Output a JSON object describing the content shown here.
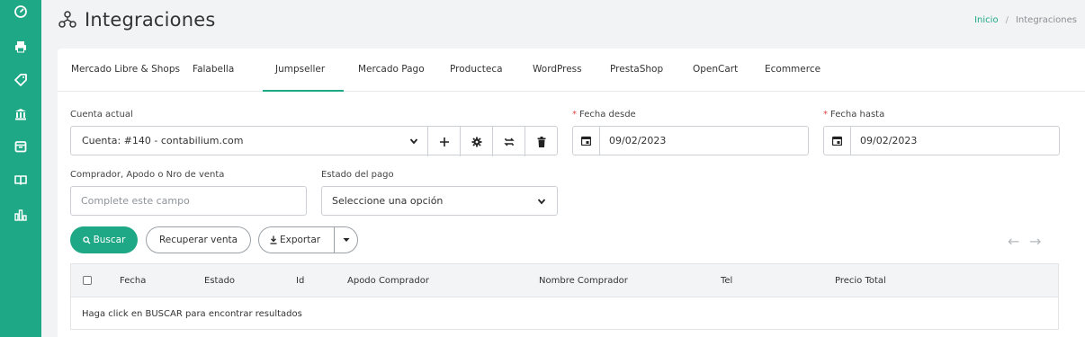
{
  "sidebar": {
    "items": [
      {
        "icon": "dashboard-gauge-icon"
      },
      {
        "icon": "printer-icon"
      },
      {
        "icon": "tag-icon"
      },
      {
        "icon": "bank-icon"
      },
      {
        "icon": "box-icon"
      },
      {
        "icon": "book-icon"
      },
      {
        "icon": "bar-chart-icon"
      }
    ]
  },
  "header": {
    "icon": "integrations-icon",
    "title": "Integraciones",
    "breadcrumb": {
      "home": "Inicio",
      "separator": "/",
      "current": "Integraciones"
    }
  },
  "tabs": [
    {
      "label": "Mercado Libre & Shops"
    },
    {
      "label": "Falabella"
    },
    {
      "label": "Jumpseller",
      "active": true
    },
    {
      "label": "Mercado Pago"
    },
    {
      "label": "Producteca"
    },
    {
      "label": "WordPress"
    },
    {
      "label": "PrestaShop"
    },
    {
      "label": "OpenCart"
    },
    {
      "label": "Ecommerce"
    }
  ],
  "form": {
    "cuenta_label": "Cuenta actual",
    "cuenta_value": "Cuenta: #140 -  contabilium.com",
    "fecha_desde_label": "Fecha desde",
    "fecha_desde_value": "09/02/2023",
    "fecha_hasta_label": "Fecha hasta",
    "fecha_hasta_value": "09/02/2023",
    "required_mark": "*",
    "comprador_label": "Comprador, Apodo o Nro de venta",
    "comprador_placeholder": "Complete este campo",
    "estado_label": "Estado del pago",
    "estado_value": "Seleccione una opción"
  },
  "actions": {
    "buscar": "Buscar",
    "recuperar": "Recuperar venta",
    "exportar": "Exportar"
  },
  "table": {
    "columns": [
      "Fecha",
      "Estado",
      "Id",
      "Apodo Comprador",
      "Nombre Comprador",
      "Tel",
      "Precio Total"
    ],
    "empty_message": "Haga click en BUSCAR para encontrar resultados"
  },
  "colors": {
    "accent": "#1fa886",
    "required": "#e04848"
  }
}
